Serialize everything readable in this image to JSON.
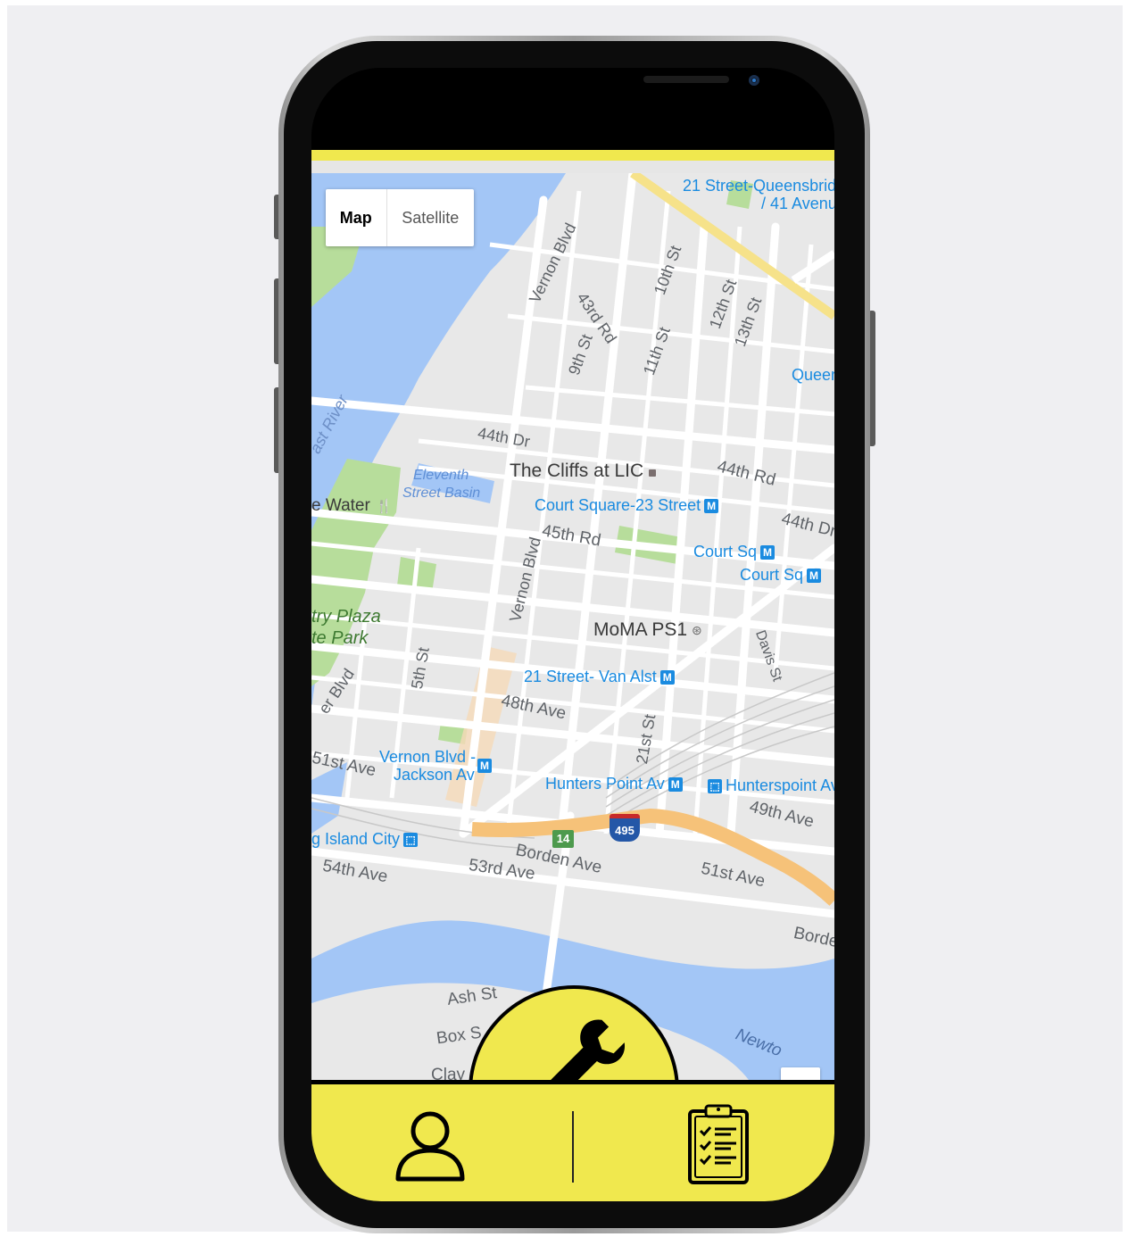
{
  "map_type": {
    "map_label": "Map",
    "satellite_label": "Satellite"
  },
  "map_labels": {
    "poi_cliffs": "The Cliffs at LIC",
    "poi_moma": "MoMA PS1",
    "poi_water": "e Water",
    "park_gantry_1": "try Plaza",
    "park_gantry_2": "te Park",
    "water_east_river": "ast River",
    "water_basin_1": "Eleventh",
    "water_basin_2": "Street Basin",
    "water_newtown": "Newto",
    "transit_court_square_23": "Court Square-23 Street",
    "transit_court_sq_1": "Court Sq",
    "transit_court_sq_2": "Court Sq",
    "transit_21st_van_alst": "21 Street- Van Alst",
    "transit_vernon_jackson_1": "Vernon Blvd -",
    "transit_vernon_jackson_2": "Jackson Av",
    "transit_hunters_point": "Hunters Point Av",
    "transit_hunterspoint_lirr": "Hunterspoint Av",
    "transit_long_island_city": "g Island City",
    "transit_queensbridge_1": "21 Street-Queensbridg",
    "transit_queensbridge_2": "/ 41 Avenu",
    "transit_queens": "Queen",
    "street_vernon_blvd_top": "Vernon Blvd",
    "street_43rd_rd": "43rd Rd",
    "street_10th_st": "10th St",
    "street_9th_st": "9th St",
    "street_11th_st": "11th St",
    "street_12th_st": "12th St",
    "street_13th_st": "13th St",
    "street_44th_dr": "44th Dr",
    "street_44th_rd": "44th Rd",
    "street_44th_dr_right": "44th Dr",
    "street_45th_rd": "45th Rd",
    "street_vernon_blvd": "Vernon Blvd",
    "street_5th_st": "5th St",
    "street_davis_st": "Davis St",
    "street_48th_ave": "48th Ave",
    "street_21st_st": "21st St",
    "street_51st_ave_left": "51st Ave",
    "street_49th_ave": "49th Ave",
    "street_borden_ave": "Borden Ave",
    "street_53rd_ave": "53rd Ave",
    "street_54th_ave": "54th Ave",
    "street_51st_ave_right": "51st Ave",
    "street_borde": "Borde",
    "street_ash_st": "Ash St",
    "street_box_st": "Box S",
    "street_clay": "Clay",
    "street_er_blvd": "er Blvd",
    "shield_495": "495",
    "shield_14": "14"
  },
  "colors": {
    "accent_yellow": "#f0e84e",
    "map_water": "#a3c6f6",
    "map_land": "#e8e8e8",
    "map_park": "#b7dd9b",
    "highway": "#f6c279"
  },
  "icons": {
    "fab": "wrench-icon",
    "profile": "user-icon",
    "list": "clipboard-checklist-icon"
  }
}
